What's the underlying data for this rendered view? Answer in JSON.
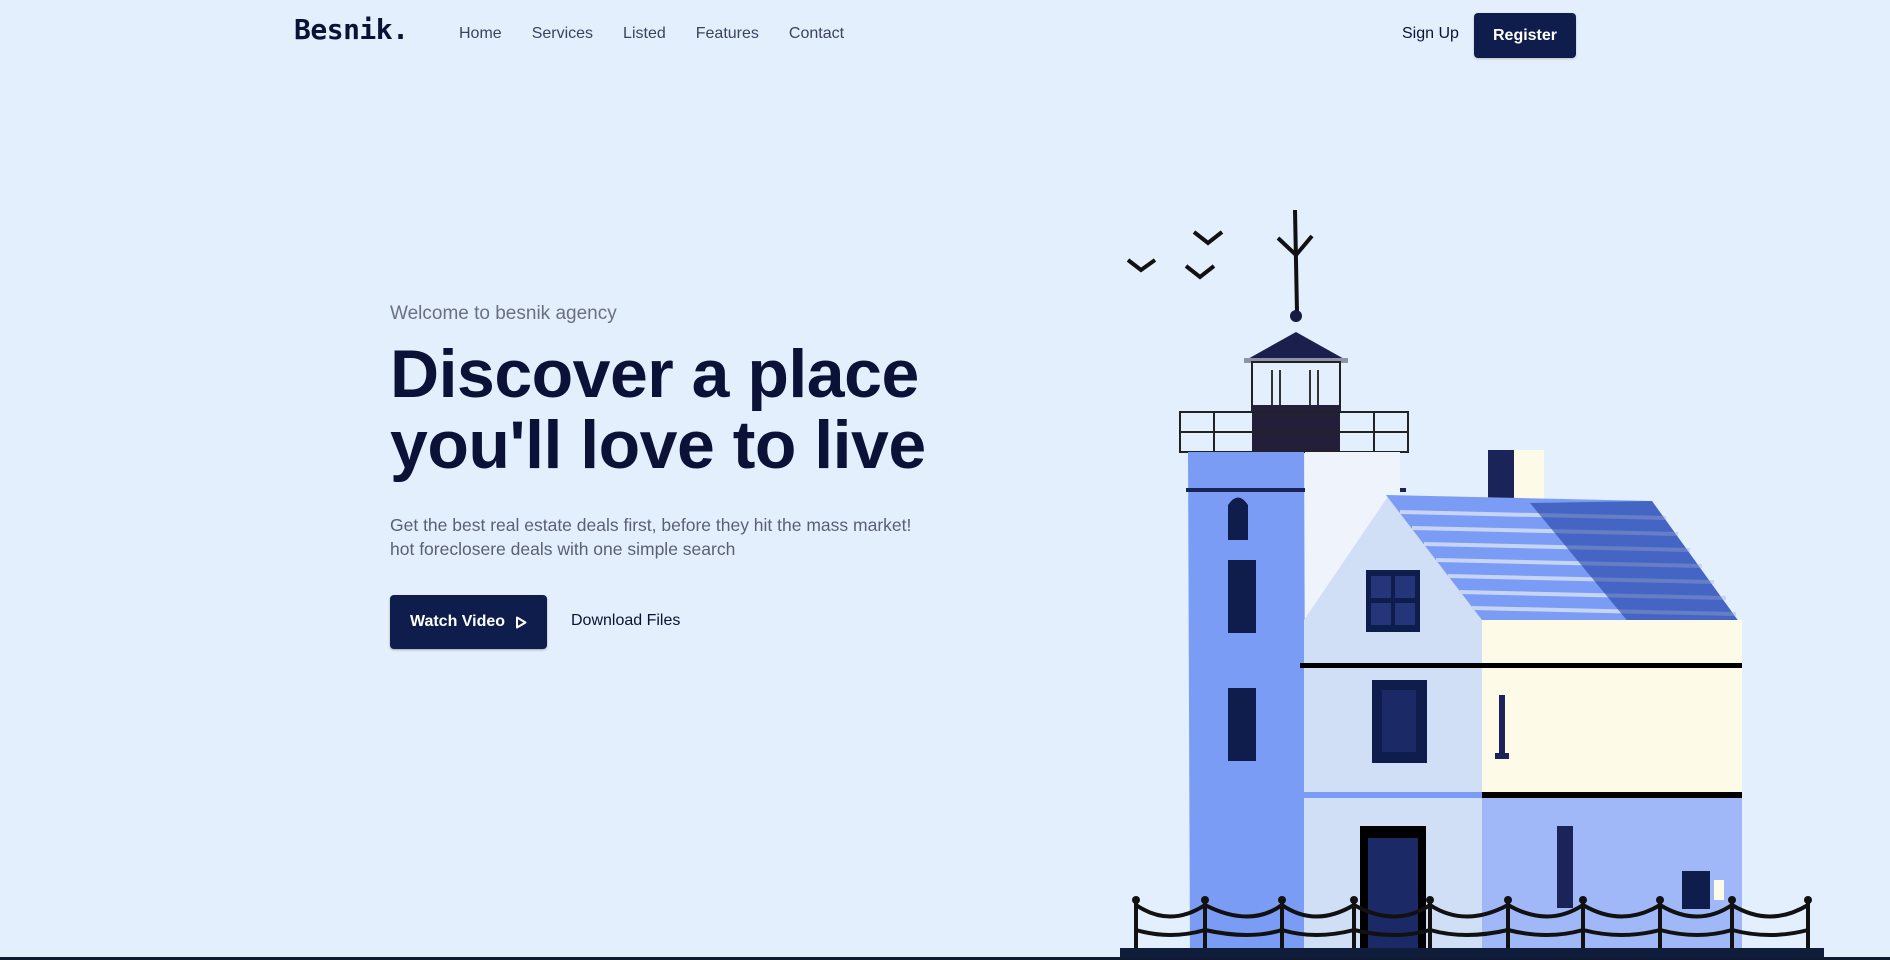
{
  "header": {
    "logo": "Besnik.",
    "nav": [
      "Home",
      "Services",
      "Listed",
      "Features",
      "Contact"
    ],
    "signup_label": "Sign Up",
    "register_label": "Register"
  },
  "hero": {
    "eyebrow": "Welcome to besnik agency",
    "title_line1": "Discover a place",
    "title_line2": "you'll love to live",
    "subtitle_line1": "Get the best real estate deals first, before they hit the mass market!",
    "subtitle_line2": "hot foreclosere deals with one simple search",
    "watch_label": "Watch Video",
    "watch_icon": "play-icon",
    "download_label": "Download Files"
  },
  "illustration": {
    "subject": "lighthouse-house-icon",
    "colors": {
      "dark": "#0f1d4c",
      "blue": "#7b9cf4",
      "light": "#d0def6",
      "cream": "#fdfbe8"
    }
  },
  "theme": {
    "background": "#e4effd",
    "accent": "#0f1d4c"
  }
}
